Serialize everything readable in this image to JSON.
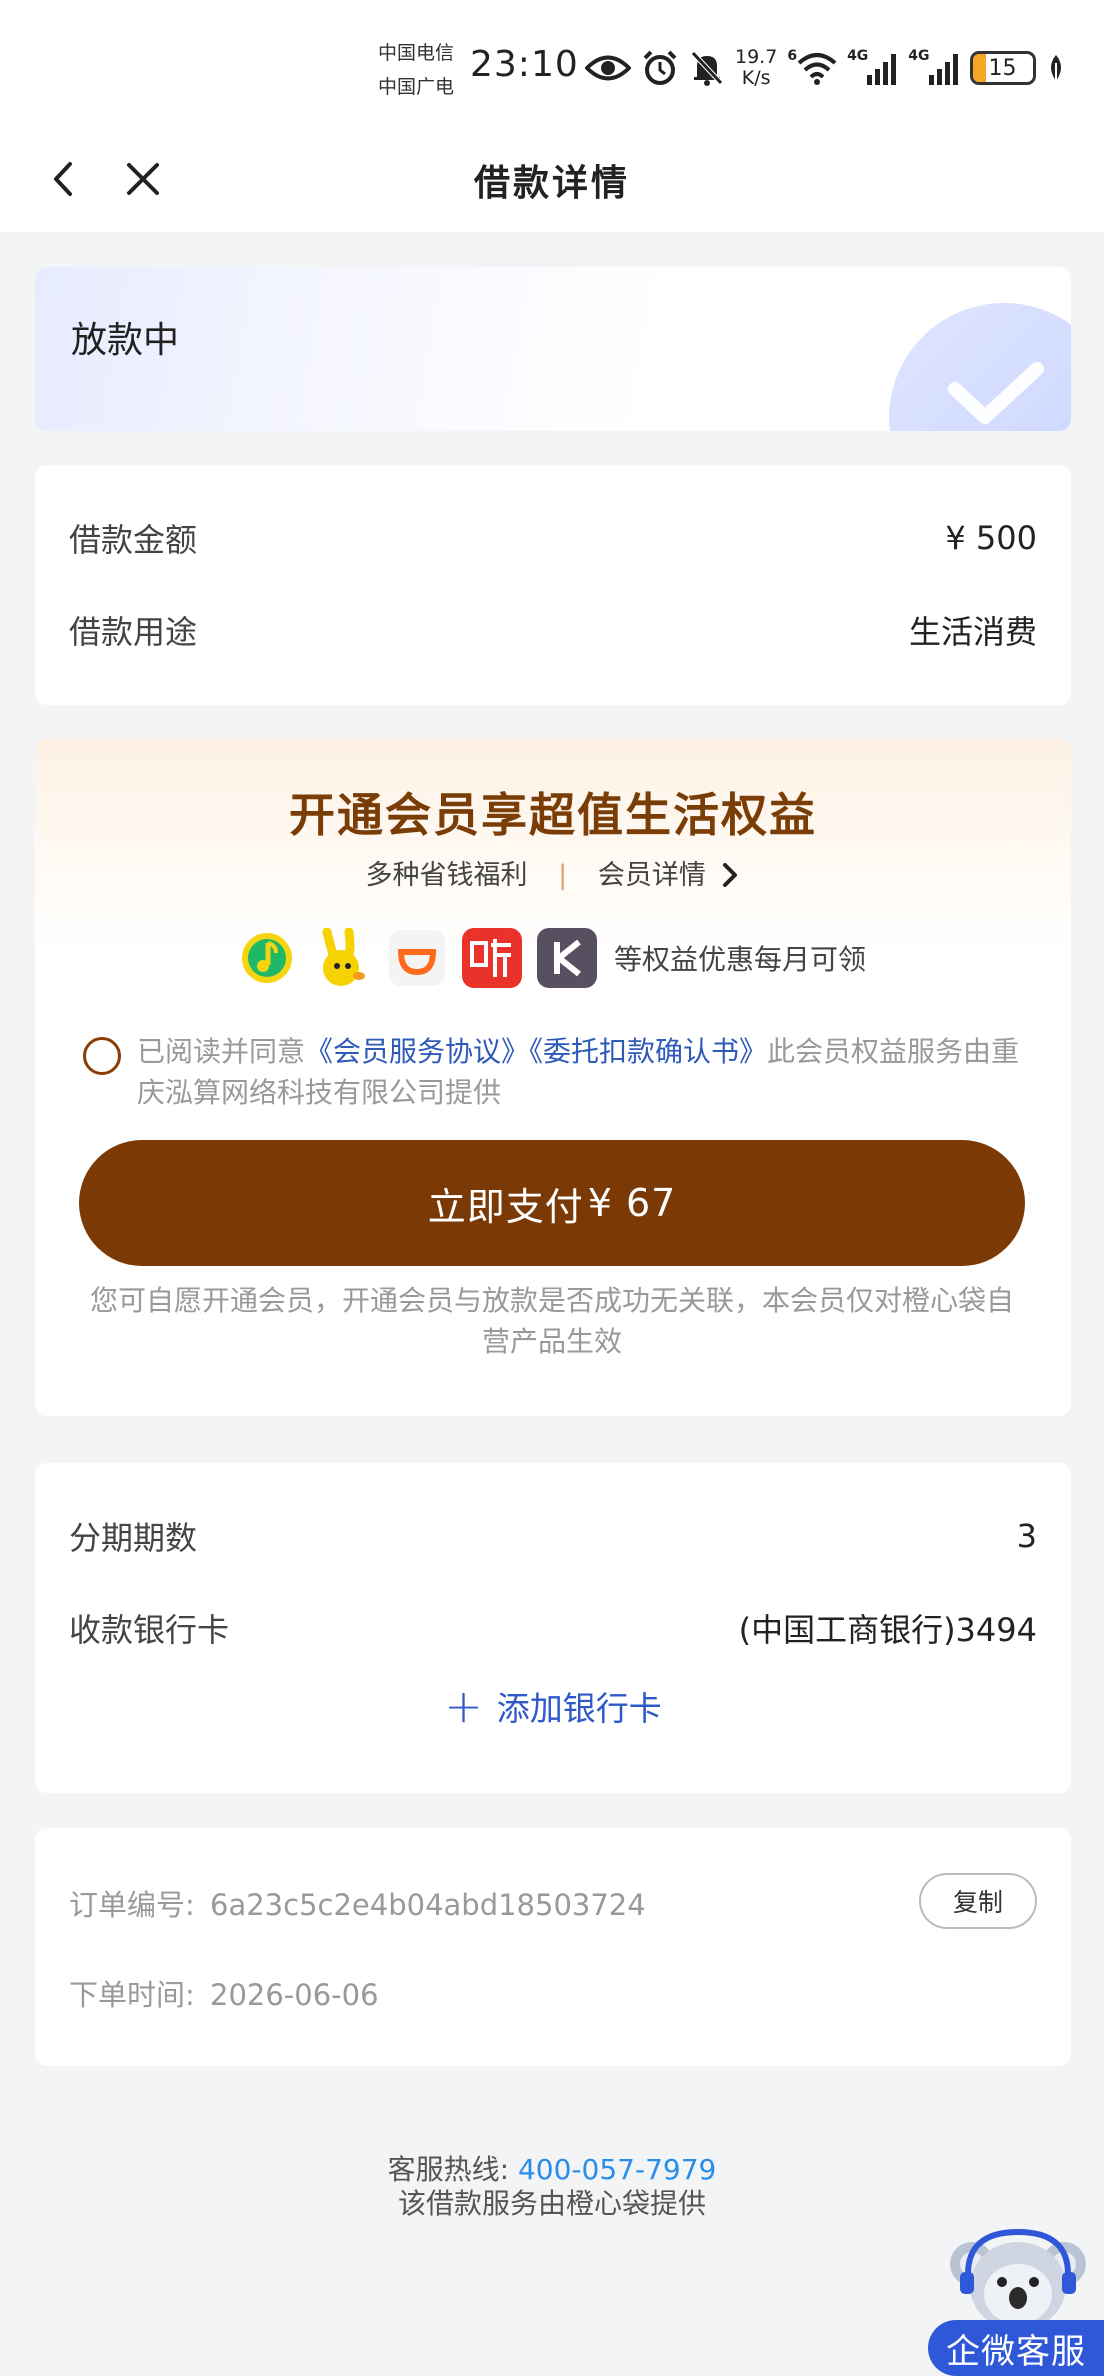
{
  "status_bar": {
    "carrier_1": "中国电信",
    "carrier_2": "中国广电",
    "time": "23:10",
    "net_speed_value": "19.7",
    "net_speed_unit": "K/s",
    "wifi_extra": "6",
    "signal_1_label": "4G",
    "signal_2_label": "4G",
    "battery": "15"
  },
  "nav": {
    "title": "借款详情"
  },
  "loan_status": {
    "text": "放款中"
  },
  "loan_info": {
    "amount_label": "借款金额",
    "amount_value": "¥ 500",
    "purpose_label": "借款用途",
    "purpose_value": "生活消费"
  },
  "membership": {
    "title": "开通会员享超值生活权益",
    "benefits_label": "多种省钱福利",
    "separator": "|",
    "details_label": "会员详情",
    "perks": [
      "qq-music-icon",
      "youku-icon",
      "didi-icon",
      "ting-audio-icon",
      "keep-icon"
    ],
    "perks_text": "等权益优惠每月可领",
    "agree_prefix": "已阅读并同意",
    "agree_link_1": "《会员服务协议》",
    "agree_link_2": "《委托扣款确认书》",
    "agree_suffix": "此会员权益服务由重庆泓算网络科技有限公司提供",
    "pay_button_label": "立即支付",
    "pay_amount": "¥ 67",
    "disclaimer": "您可自愿开通会员，开通会员与放款是否成功无关联，本会员仅对橙心袋自营产品生效"
  },
  "repayment_info": {
    "periods_label": "分期期数",
    "periods_value": "3",
    "bank_label": "收款银行卡",
    "bank_value": "(中国工商银行)3494",
    "add_card_plus": "+",
    "add_card_label": "添加银行卡"
  },
  "order": {
    "number_label": "订单编号:",
    "number_value": "6a23c5c2e4b04abd18503724",
    "copy_label": "复制",
    "time_label": "下单时间:",
    "time_value": "2026-06-06"
  },
  "footer": {
    "hotline_label": "客服热线:",
    "hotline_value": "400-057-7979",
    "provider_text": "该借款服务由橙心袋提供"
  },
  "support": {
    "label": "企微客服"
  },
  "colors": {
    "brand_brown": "#7b3a05",
    "title_brown": "#7a3d06",
    "link_blue": "#2e5ab8",
    "hotline_blue": "#2a8ee8",
    "support_blue": "#2f58d8"
  }
}
